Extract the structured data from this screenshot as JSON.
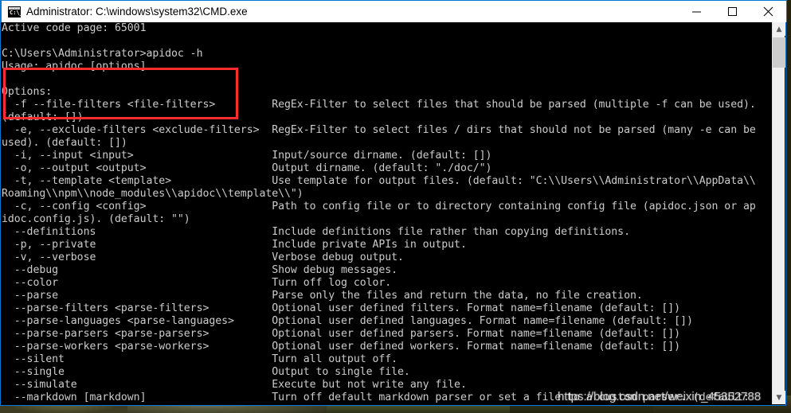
{
  "window": {
    "title": "Administrator: C:\\windows\\system32\\CMD.exe",
    "icon_label": "C:\\_",
    "controls": {
      "minimize": "minimize-button",
      "maximize": "maximize-button",
      "close": "close-button"
    }
  },
  "annotation": {
    "type": "red-rectangle-highlight",
    "color": "#ff2d2d"
  },
  "watermark": {
    "text": "https://blog.csdn.net/weixin_45352788"
  },
  "scrollbar": {
    "up_arrow": "▲",
    "down_arrow": "▼"
  },
  "terminal": {
    "foreground": "#cccccc",
    "background": "#000000",
    "lines": [
      "Active code page: 65001",
      "",
      "C:\\Users\\Administrator>apidoc -h",
      "Usage: apidoc [options]",
      "",
      "Options:",
      "  -f --file-filters <file-filters>         RegEx-Filter to select files that should be parsed (multiple -f can be used).",
      "(default: [])",
      "  -e, --exclude-filters <exclude-filters>  RegEx-Filter to select files / dirs that should not be parsed (many -e can be",
      "used). (default: [])",
      "  -i, --input <input>                      Input/source dirname. (default: [])",
      "  -o, --output <output>                    Output dirname. (default: \"./doc/\")",
      "  -t, --template <template>                Use template for output files. (default: \"C:\\\\Users\\\\Administrator\\\\AppData\\\\",
      "Roaming\\\\npm\\\\node_modules\\\\apidoc\\\\template\\\\\")",
      "  -c, --config <config>                    Path to config file or to directory containing config file (apidoc.json or ap",
      "idoc.config.js). (default: \"\")",
      "  --definitions                            Include definitions file rather than copying definitions.",
      "  -p, --private                            Include private APIs in output.",
      "  -v, --verbose                            Verbose debug output.",
      "  --debug                                  Show debug messages.",
      "  --color                                  Turn off log color.",
      "  --parse                                  Parse only the files and return the data, no file creation.",
      "  --parse-filters <parse-filters>          Optional user defined filters. Format name=filename (default: [])",
      "  --parse-languages <parse-languages>      Optional user defined languages. Format name=filename (default: [])",
      "  --parse-parsers <parse-parsers>          Optional user defined parsers. Format name=filename (default: [])",
      "  --parse-workers <parse-workers>          Optional user defined workers. Format name=filename (default: [])",
      "  --silent                                 Turn all output off.",
      "  --single                                 Output to single file.",
      "  --simulate                               Execute but not write any file.",
      "  --markdown [markdown]                    Turn off default markdown parser or set a file to a custom parser. (default:"
    ]
  }
}
